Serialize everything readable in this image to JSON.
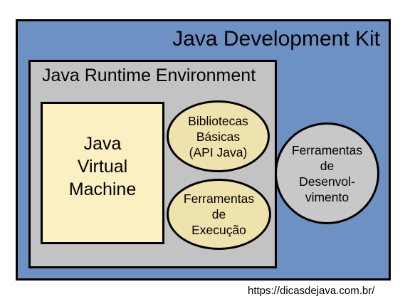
{
  "jdk": {
    "title": "Java Development Kit"
  },
  "jre": {
    "title": "Java Runtime Environment"
  },
  "jvm": {
    "lines": [
      "Java",
      "Virtual",
      "Machine"
    ]
  },
  "libraries": {
    "lines": [
      "Bibliotecas",
      "Básicas",
      "(API Java)"
    ]
  },
  "execution_tools": {
    "lines": [
      "Ferramentas",
      "de",
      "Execução"
    ]
  },
  "development_tools": {
    "lines": [
      "Ferramentas",
      "de",
      "Desenvol-",
      "vimento"
    ]
  },
  "footer": {
    "url": "https://dicasdejava.com.br/"
  },
  "colors": {
    "jdk": "#6d91c2",
    "jre": "#c3c3c3",
    "jvm": "#fbf0c2",
    "ellipse": "#efe3ad",
    "dev_ellipse": "#c8c8c8"
  }
}
